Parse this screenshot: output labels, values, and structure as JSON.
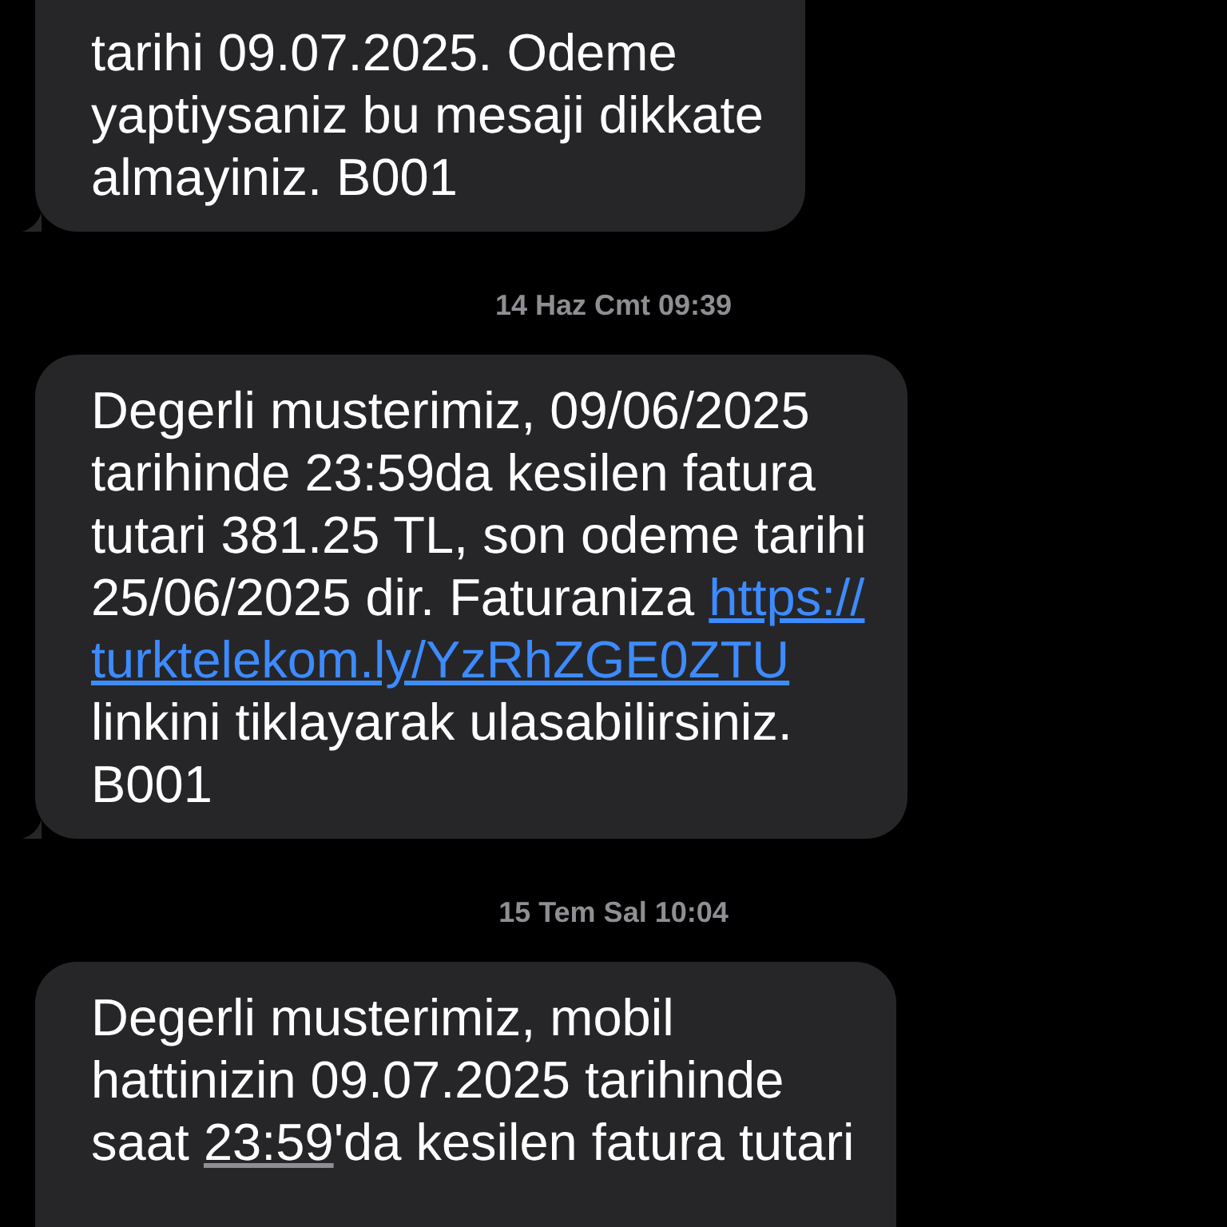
{
  "messages": [
    {
      "lines": [
        [
          {
            "kind": "text",
            "text": "tarihi 09.07.2025. Odeme"
          }
        ],
        [
          {
            "kind": "text",
            "text": "yaptiysaniz bu mesaji dikkate"
          }
        ],
        [
          {
            "kind": "text",
            "text": "almayiniz. B001"
          }
        ]
      ]
    },
    {
      "timestamp": "14 Haz Cmt 09:39",
      "lines": [
        [
          {
            "kind": "text",
            "text": "Degerli musterimiz, 09/06/2025"
          }
        ],
        [
          {
            "kind": "text",
            "text": "tarihinde 23:59da kesilen fatura"
          }
        ],
        [
          {
            "kind": "text",
            "text": "tutari 381.25 TL, son odeme tarihi"
          }
        ],
        [
          {
            "kind": "text",
            "text": "25/06/2025 dir. Faturaniza "
          },
          {
            "kind": "link",
            "text": "https://"
          }
        ],
        [
          {
            "kind": "link",
            "text": "turktelekom.ly/YzRhZGE0ZTU"
          }
        ],
        [
          {
            "kind": "text",
            "text": "linkini tiklayarak ulasabilirsiniz."
          }
        ],
        [
          {
            "kind": "text",
            "text": "B001"
          }
        ]
      ]
    },
    {
      "timestamp": "15 Tem Sal 10:04",
      "lines": [
        [
          {
            "kind": "text",
            "text": "Degerli musterimiz, mobil"
          }
        ],
        [
          {
            "kind": "text",
            "text": "hattinizin 09.07.2025 tarihinde"
          }
        ],
        [
          {
            "kind": "text",
            "text": "saat "
          },
          {
            "kind": "detected",
            "text": "23:59"
          },
          {
            "kind": "text",
            "text": "'da kesilen fatura tutari"
          }
        ]
      ]
    }
  ]
}
